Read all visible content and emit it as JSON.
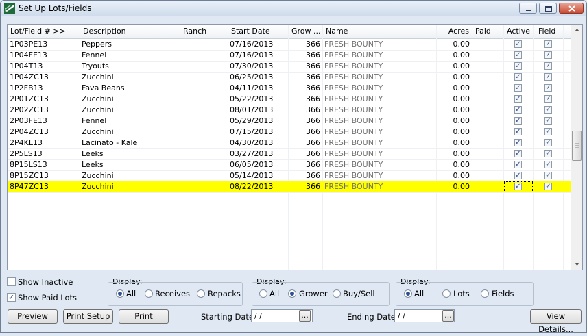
{
  "window": {
    "title": "Set Up Lots/Fields"
  },
  "grid": {
    "columns": [
      {
        "key": "lot",
        "label": "Lot/Field # >>"
      },
      {
        "key": "desc",
        "label": "Description"
      },
      {
        "key": "ranch",
        "label": "Ranch"
      },
      {
        "key": "start",
        "label": "Start Date"
      },
      {
        "key": "grow",
        "label": "Grow ..."
      },
      {
        "key": "name",
        "label": "Name"
      },
      {
        "key": "acres",
        "label": "Acres"
      },
      {
        "key": "paid",
        "label": "Paid"
      },
      {
        "key": "active",
        "label": "Active"
      },
      {
        "key": "field",
        "label": "Field"
      }
    ],
    "rows": [
      {
        "lot": "1P03PE13",
        "desc": "Peppers",
        "ranch": "",
        "start": "07/16/2013",
        "grow": "366",
        "name": "FRESH BOUNTY",
        "acres": "0.00",
        "paid": "",
        "active": true,
        "field": true
      },
      {
        "lot": "1P04FE13",
        "desc": "Fennel",
        "ranch": "",
        "start": "07/16/2013",
        "grow": "366",
        "name": "FRESH BOUNTY",
        "acres": "0.00",
        "paid": "",
        "active": true,
        "field": true
      },
      {
        "lot": "1P04T13",
        "desc": "Tryouts",
        "ranch": "",
        "start": "07/30/2013",
        "grow": "366",
        "name": "FRESH BOUNTY",
        "acres": "0.00",
        "paid": "",
        "active": true,
        "field": true
      },
      {
        "lot": "1P04ZC13",
        "desc": "Zucchini",
        "ranch": "",
        "start": "06/25/2013",
        "grow": "366",
        "name": "FRESH BOUNTY",
        "acres": "0.00",
        "paid": "",
        "active": true,
        "field": true
      },
      {
        "lot": "1P2FB13",
        "desc": "Fava Beans",
        "ranch": "",
        "start": "04/11/2013",
        "grow": "366",
        "name": "FRESH BOUNTY",
        "acres": "0.00",
        "paid": "",
        "active": true,
        "field": true
      },
      {
        "lot": "2P01ZC13",
        "desc": "Zucchini",
        "ranch": "",
        "start": "05/22/2013",
        "grow": "366",
        "name": "FRESH BOUNTY",
        "acres": "0.00",
        "paid": "",
        "active": true,
        "field": true
      },
      {
        "lot": "2P02ZC13",
        "desc": "Zucchini",
        "ranch": "",
        "start": "08/01/2013",
        "grow": "366",
        "name": "FRESH BOUNTY",
        "acres": "0.00",
        "paid": "",
        "active": true,
        "field": true
      },
      {
        "lot": "2P03FE13",
        "desc": "Fennel",
        "ranch": "",
        "start": "05/29/2013",
        "grow": "366",
        "name": "FRESH BOUNTY",
        "acres": "0.00",
        "paid": "",
        "active": true,
        "field": true
      },
      {
        "lot": "2P04ZC13",
        "desc": "Zucchini",
        "ranch": "",
        "start": "07/15/2013",
        "grow": "366",
        "name": "FRESH BOUNTY",
        "acres": "0.00",
        "paid": "",
        "active": true,
        "field": true
      },
      {
        "lot": "2P4KL13",
        "desc": "Lacinato - Kale",
        "ranch": "",
        "start": "04/30/2013",
        "grow": "366",
        "name": "FRESH BOUNTY",
        "acres": "0.00",
        "paid": "",
        "active": true,
        "field": true
      },
      {
        "lot": "2P5LS13",
        "desc": "Leeks",
        "ranch": "",
        "start": "03/27/2013",
        "grow": "366",
        "name": "FRESH BOUNTY",
        "acres": "0.00",
        "paid": "",
        "active": true,
        "field": true
      },
      {
        "lot": "8P15LS13",
        "desc": "Leeks",
        "ranch": "",
        "start": "06/05/2013",
        "grow": "366",
        "name": "FRESH BOUNTY",
        "acres": "0.00",
        "paid": "",
        "active": true,
        "field": true
      },
      {
        "lot": "8P15ZC13",
        "desc": "Zucchini",
        "ranch": "",
        "start": "05/14/2013",
        "grow": "366",
        "name": "FRESH BOUNTY",
        "acres": "0.00",
        "paid": "",
        "active": true,
        "field": true
      },
      {
        "lot": "8P47ZC13",
        "desc": "Zucchini",
        "ranch": "",
        "start": "08/22/2013",
        "grow": "366",
        "name": "FRESH BOUNTY",
        "acres": "0.00",
        "paid": "",
        "active": true,
        "field": true,
        "selected": true
      }
    ]
  },
  "filters": {
    "show_inactive": {
      "label": "Show Inactive",
      "checked": false
    },
    "show_paid": {
      "label": "Show Paid Lots",
      "checked": true
    },
    "display1": {
      "label": "Display:",
      "options": [
        "All",
        "Receives",
        "Repacks"
      ],
      "selected": "All"
    },
    "display2": {
      "label": "Display:",
      "options": [
        "All",
        "Grower",
        "Buy/Sell"
      ],
      "selected": "Grower"
    },
    "display3": {
      "label": "Display:",
      "options": [
        "All",
        "Lots",
        "Fields"
      ],
      "selected": "All"
    }
  },
  "footer": {
    "preview": "Preview",
    "print_setup": "Print Setup",
    "print": "Print",
    "starting_date_label": "Starting Date:",
    "starting_date_value": "/ /",
    "ending_date_label": "Ending Date:",
    "ending_date_value": "/ /",
    "ellipsis": "...",
    "view_details": "View Details..."
  },
  "colors": {
    "selected_row": "#ffff00",
    "name_text": "#707070",
    "check_mark": "#3b4e8c"
  }
}
